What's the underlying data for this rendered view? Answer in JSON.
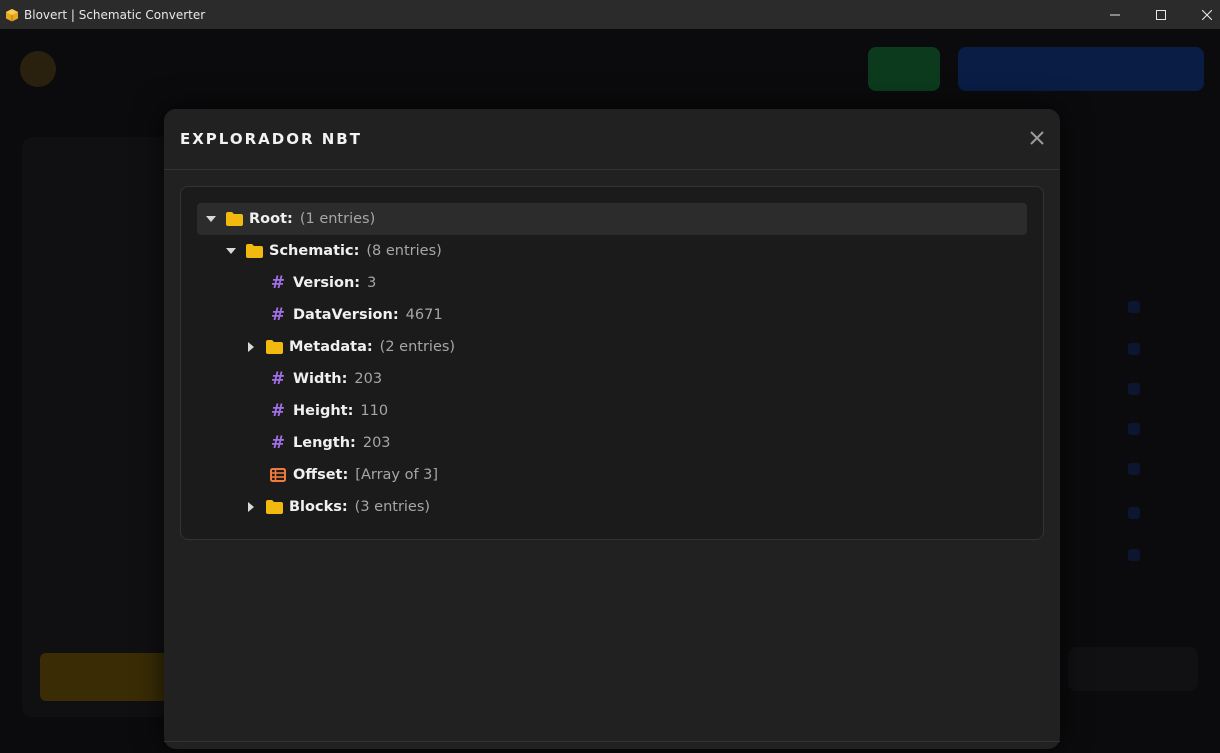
{
  "window": {
    "title": "Blovert | Schematic Converter"
  },
  "modal": {
    "title": "EXPLORADOR NBT",
    "close_icon": "close-icon"
  },
  "tree": {
    "root": {
      "key": "Root:",
      "value": "(1 entries)",
      "icon": "folder-icon",
      "expanded": true
    },
    "schematic": {
      "key": "Schematic:",
      "value": "(8 entries)",
      "icon": "folder-icon",
      "expanded": true
    },
    "version": {
      "key": "Version:",
      "value": "3",
      "icon": "hash-icon"
    },
    "dataversion": {
      "key": "DataVersion:",
      "value": "4671",
      "icon": "hash-icon"
    },
    "metadata": {
      "key": "Metadata:",
      "value": "(2 entries)",
      "icon": "folder-icon",
      "expanded": false
    },
    "width": {
      "key": "Width:",
      "value": "203",
      "icon": "hash-icon"
    },
    "height": {
      "key": "Height:",
      "value": "110",
      "icon": "hash-icon"
    },
    "length": {
      "key": "Length:",
      "value": "203",
      "icon": "hash-icon"
    },
    "offset": {
      "key": "Offset:",
      "value": "[Array of 3]",
      "icon": "array-icon"
    },
    "blocks": {
      "key": "Blocks:",
      "value": "(3 entries)",
      "icon": "folder-icon",
      "expanded": false
    },
    "hash_glyph": "#"
  },
  "colors": {
    "folder": "#f2b90f",
    "number": "#a070e6",
    "array": "#f07a3a",
    "modal_bg": "#212121",
    "panel_bg": "#1b1b1b",
    "selected_row": "#2c2c2c"
  }
}
